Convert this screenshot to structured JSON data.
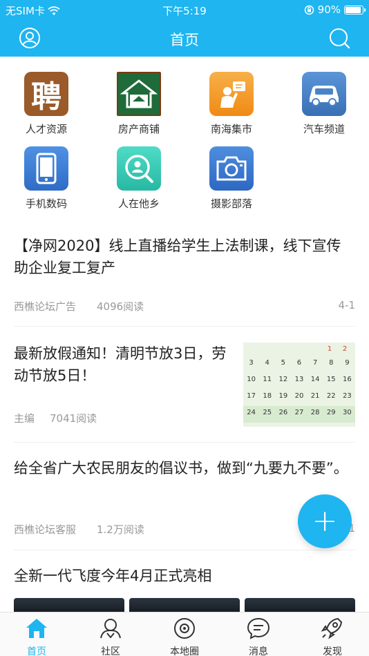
{
  "status_bar": {
    "carrier": "无SIM卡",
    "time": "下午5:19",
    "battery": "90%",
    "battery_level": 0.9
  },
  "navbar": {
    "title": "首页"
  },
  "categories": [
    {
      "label": "人才资源",
      "icon": "hire-icon",
      "glyph": "聘",
      "color": "#9a5a2a"
    },
    {
      "label": "房产商铺",
      "icon": "house-icon",
      "color": "#1f6b3a"
    },
    {
      "label": "南海集市",
      "icon": "market-icon",
      "color": "#f4a022"
    },
    {
      "label": "汽车频道",
      "icon": "car-icon",
      "color": "#4a84c8"
    },
    {
      "label": "手机数码",
      "icon": "phone-icon",
      "color": "#3d7fd6"
    },
    {
      "label": "人在他乡",
      "icon": "person-search-icon",
      "color": "#3ccdb9"
    },
    {
      "label": "摄影部落",
      "icon": "camera-icon",
      "color": "#3b7bd0"
    }
  ],
  "articles": [
    {
      "title": "【净网2020】线上直播给学生上法制课，线下宣传助企业复工复产",
      "source": "西樵论坛广告",
      "reads": "4096阅读",
      "date": "4-1"
    },
    {
      "title": "最新放假通知！清明节放3日，劳动节放5日！",
      "source": "主编",
      "reads": "7041阅读"
    },
    {
      "title": "给全省广大农民朋友的倡议书，做到“九要九不要”。",
      "source": "西樵论坛客服",
      "reads": "1.2万阅读",
      "date": "1"
    },
    {
      "title": "全新一代飞度今年4月正式亮相"
    }
  ],
  "calendar": {
    "top": [
      "1",
      "2"
    ],
    "weeks": [
      [
        "3",
        "4",
        "5",
        "6",
        "7",
        "8",
        "9"
      ],
      [
        "10",
        "11",
        "12",
        "13",
        "14",
        "15",
        "16"
      ],
      [
        "17",
        "18",
        "19",
        "20",
        "21",
        "22",
        "23"
      ],
      [
        "24",
        "25",
        "26",
        "27",
        "28",
        "29",
        "30"
      ]
    ]
  },
  "fab": {
    "label": "+"
  },
  "tabs": [
    {
      "label": "首页",
      "icon": "home-icon",
      "active": true
    },
    {
      "label": "社区",
      "icon": "community-icon",
      "active": false
    },
    {
      "label": "本地圈",
      "icon": "local-circle-icon",
      "active": false
    },
    {
      "label": "消息",
      "icon": "message-icon",
      "active": false
    },
    {
      "label": "发现",
      "icon": "rocket-icon",
      "active": false
    }
  ],
  "colors": {
    "brand": "#1eb5f0",
    "meta_text": "#999999"
  }
}
